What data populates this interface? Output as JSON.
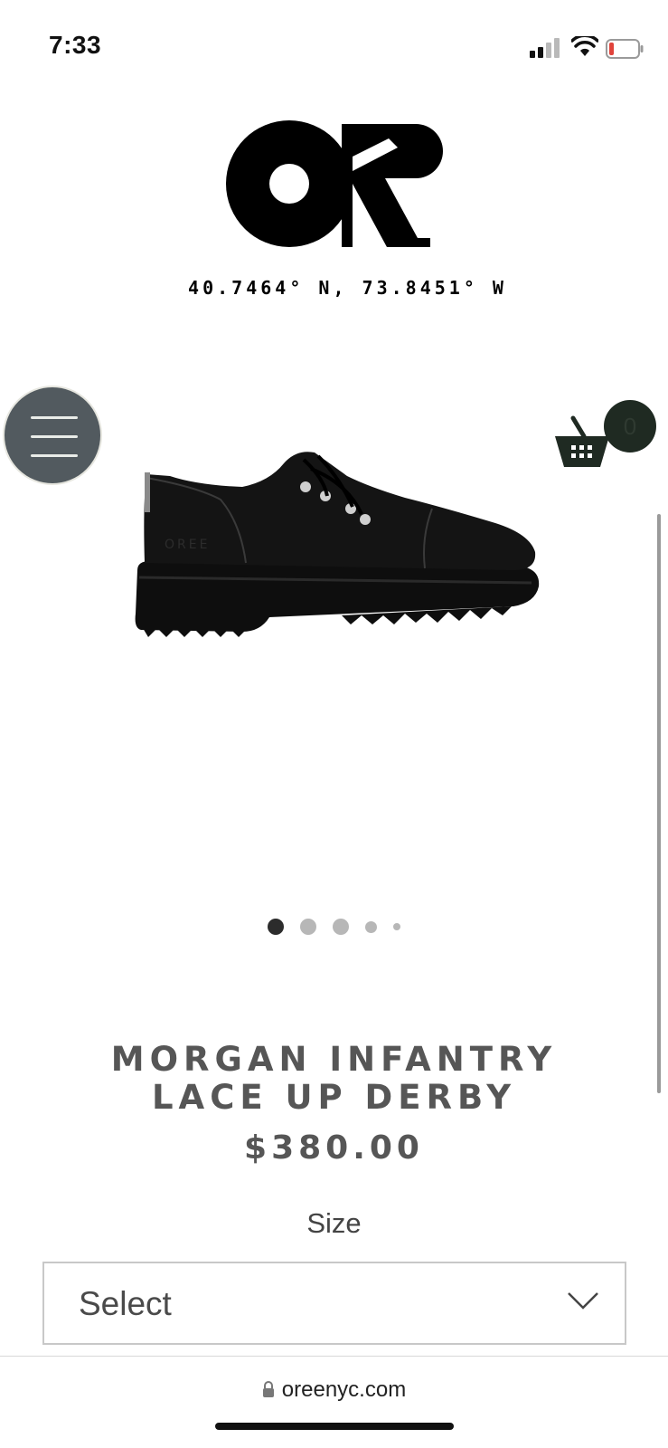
{
  "status_bar": {
    "time": "7:33",
    "icons": [
      "cellular-signal-icon",
      "wifi-icon",
      "battery-low-icon"
    ]
  },
  "brand": {
    "logo_text": "OR",
    "coordinates": "40.7464° N, 73.8451° W"
  },
  "nav": {
    "menu_icon": "hamburger-menu-icon",
    "cart_icon": "shopping-basket-icon",
    "cart_count": "0"
  },
  "product": {
    "image_alt": "black leather lace up derby shoe",
    "carousel": {
      "total_images": 5,
      "active_index": 0
    },
    "title_line1": "MORGAN INFANTRY",
    "title_line2": "LACE UP DERBY",
    "price": "$380.00",
    "size_label": "Size",
    "size_select": {
      "selected": "Select"
    }
  },
  "browser": {
    "url": "oreenyc.com"
  },
  "colors": {
    "menu_button_bg": "#525a5f",
    "cart_badge_bg": "#1f2a22",
    "title_text": "#565656",
    "battery_low": "#e0433b"
  }
}
